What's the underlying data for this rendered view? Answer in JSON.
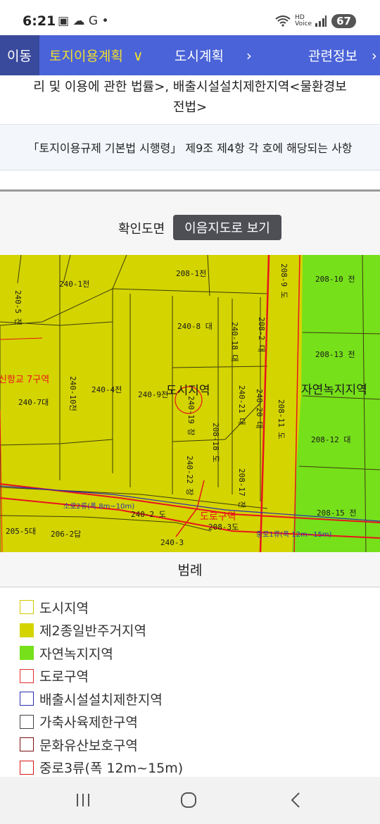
{
  "status_bar": {
    "time": "6:21",
    "left_icons": "▣ ☁ G •",
    "network_label": "HD Voice",
    "signal_label": "5",
    "battery": "67"
  },
  "nav": {
    "tabs": [
      {
        "label": "이동"
      },
      {
        "label": "토지이용계획",
        "chevron": "∨",
        "active": true
      },
      {
        "label": "도시계획",
        "chevron": "›"
      },
      {
        "label": "관련정보",
        "chevron": "›"
      }
    ]
  },
  "law_text": {
    "line1": "리 및 이용에 관한 법률>, 배출시설설치제한지역<물환경보",
    "line2": "전법>"
  },
  "regulation_text": "「토지이용규제 기본법 시행령」 제9조 제4항 각 호에 해당되는 사항",
  "map_section": {
    "label": "확인도면",
    "map_button": "이음지도로 보기"
  },
  "map": {
    "parcel_labels": [
      "240-5 전",
      "240-1전",
      "208-1전",
      "208-9 도",
      "208-10 전",
      "240-8 대",
      "240-18 대",
      "208-2 대",
      "208-13 전",
      "240-7대",
      "240-10전",
      "240-4전",
      "240-9전",
      "240-19 장",
      "240-21 대",
      "240-20 대",
      "208-11 도",
      "208-12 대",
      "208-18 도",
      "240-22 장",
      "208-17 전",
      "208-15 전",
      "205-5대",
      "206-2답",
      "240-2 도",
      "208-3도",
      "240-3"
    ],
    "zone_labels": {
      "urban": "도시지역",
      "natural_green": "자연녹지지역",
      "school_zone": "신항교 7구역",
      "road_zone": "도로구역",
      "minor_road": "소로2류(폭 8m~10m)",
      "main_road": "중로1류(폭 12m~15m)"
    },
    "colors": {
      "residential": "#d4d400",
      "green": "#76e01a",
      "boundary": "#e8141c"
    }
  },
  "legend": {
    "title": "범례",
    "items": [
      {
        "label": "도시지역",
        "fill": "#ffffff",
        "border": "#d4c800"
      },
      {
        "label": "제2종일반주거지역",
        "fill": "#d4d400",
        "border": "#d4d400"
      },
      {
        "label": "자연녹지지역",
        "fill": "#76e01a",
        "border": "#76e01a"
      },
      {
        "label": "도로구역",
        "fill": "#ffffff",
        "border": "#e03030"
      },
      {
        "label": "배출시설설치제한지역",
        "fill": "#ffffff",
        "border": "#2b2fb0"
      },
      {
        "label": "가축사육제한구역",
        "fill": "#ffffff",
        "border": "#444444"
      },
      {
        "label": "문화유산보호구역",
        "fill": "#ffffff",
        "border": "#7a1010"
      },
      {
        "label": "중로3류(폭 12m~15m)",
        "fill": "#ffffff",
        "border": "#d81818"
      }
    ]
  },
  "bottom_nav": {
    "recent_icon": "recent-apps-icon",
    "home_icon": "home-icon",
    "back_icon": "back-icon"
  }
}
